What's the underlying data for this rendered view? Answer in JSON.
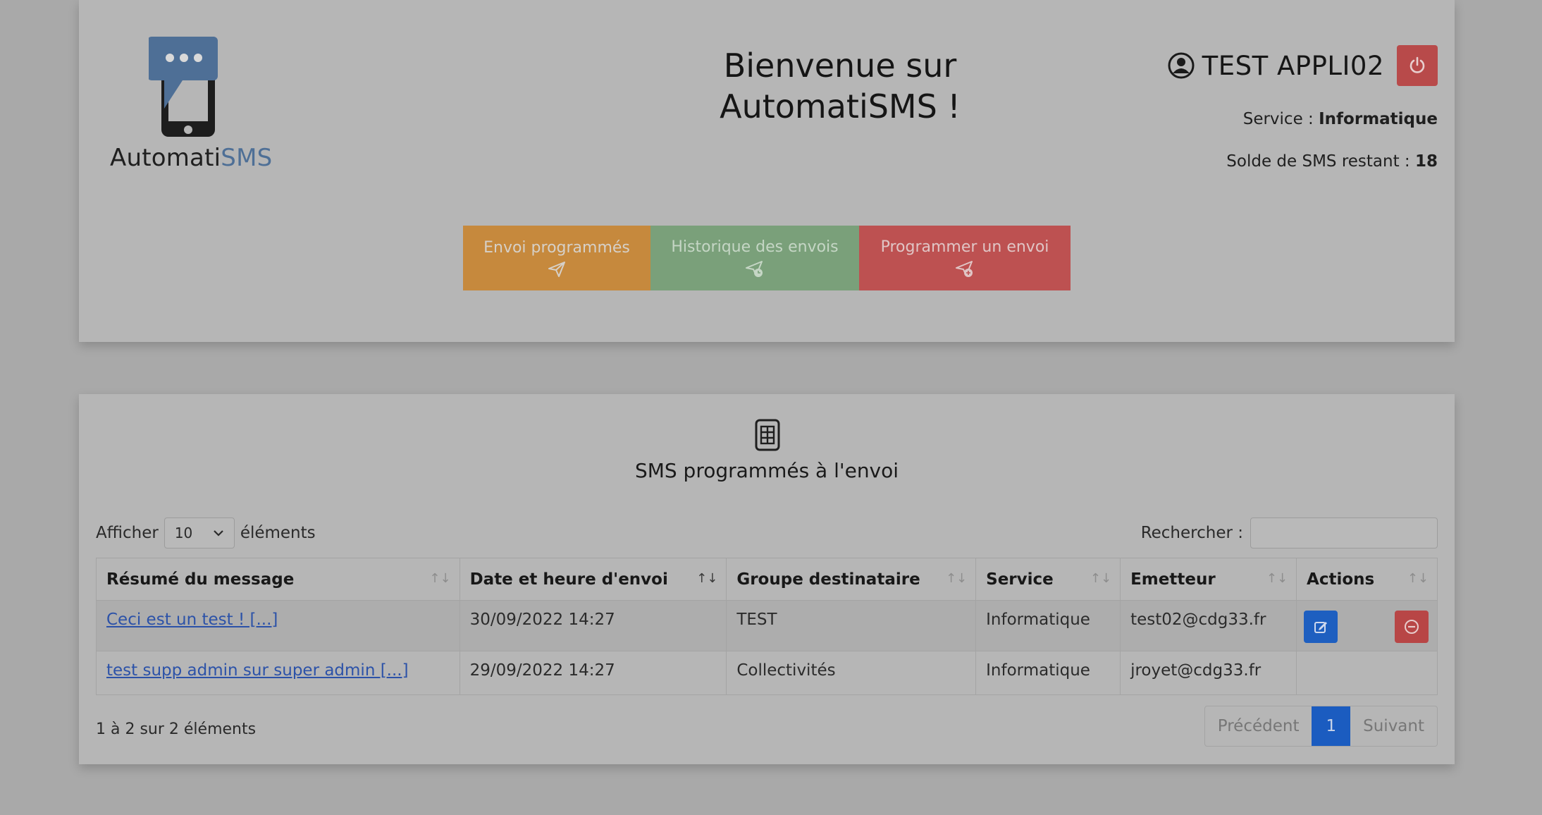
{
  "header": {
    "logo_text_main": "Automati",
    "logo_text_accent": "SMS",
    "welcome_line1": "Bienvenue sur",
    "welcome_line2": "AutomatiSMS !",
    "user_name": "TEST APPLI02",
    "service_label": "Service :",
    "service_value": "Informatique",
    "solde_label": "Solde de SMS restant :",
    "solde_value": "18",
    "nav": [
      {
        "label": "Envoi programmés",
        "icon": "paper-plane-icon"
      },
      {
        "label": "Historique des envois",
        "icon": "paper-plane-clock-icon"
      },
      {
        "label": "Programmer un envoi",
        "icon": "paper-plane-plus-icon"
      }
    ]
  },
  "table_section": {
    "title": "SMS programmés à l'envoi",
    "length_prefix": "Afficher",
    "length_value": "10",
    "length_suffix": "éléments",
    "search_label": "Rechercher :",
    "search_value": "",
    "columns": [
      "Résumé du message",
      "Date et heure d'envoi",
      "Groupe destinataire",
      "Service",
      "Emetteur",
      "Actions"
    ],
    "rows": [
      {
        "message": "Ceci est un test ! [...]",
        "date": "30/09/2022 14:27",
        "group": "TEST",
        "service": "Informatique",
        "sender": "test02@cdg33.fr"
      },
      {
        "message": "test supp admin sur super admin [...]",
        "date": "29/09/2022 14:27",
        "group": "Collectivités",
        "service": "Informatique",
        "sender": "jroyet@cdg33.fr"
      }
    ],
    "info": "1 à 2 sur 2 éléments",
    "pager": {
      "prev": "Précédent",
      "current": "1",
      "next": "Suivant"
    }
  },
  "colors": {
    "background": "#a9a9a9",
    "card": "#b6b6b6",
    "btn_orange": "#c6893d",
    "btn_green": "#7aa07a",
    "btn_red": "#bd5151",
    "primary": "#1b5cc0"
  }
}
